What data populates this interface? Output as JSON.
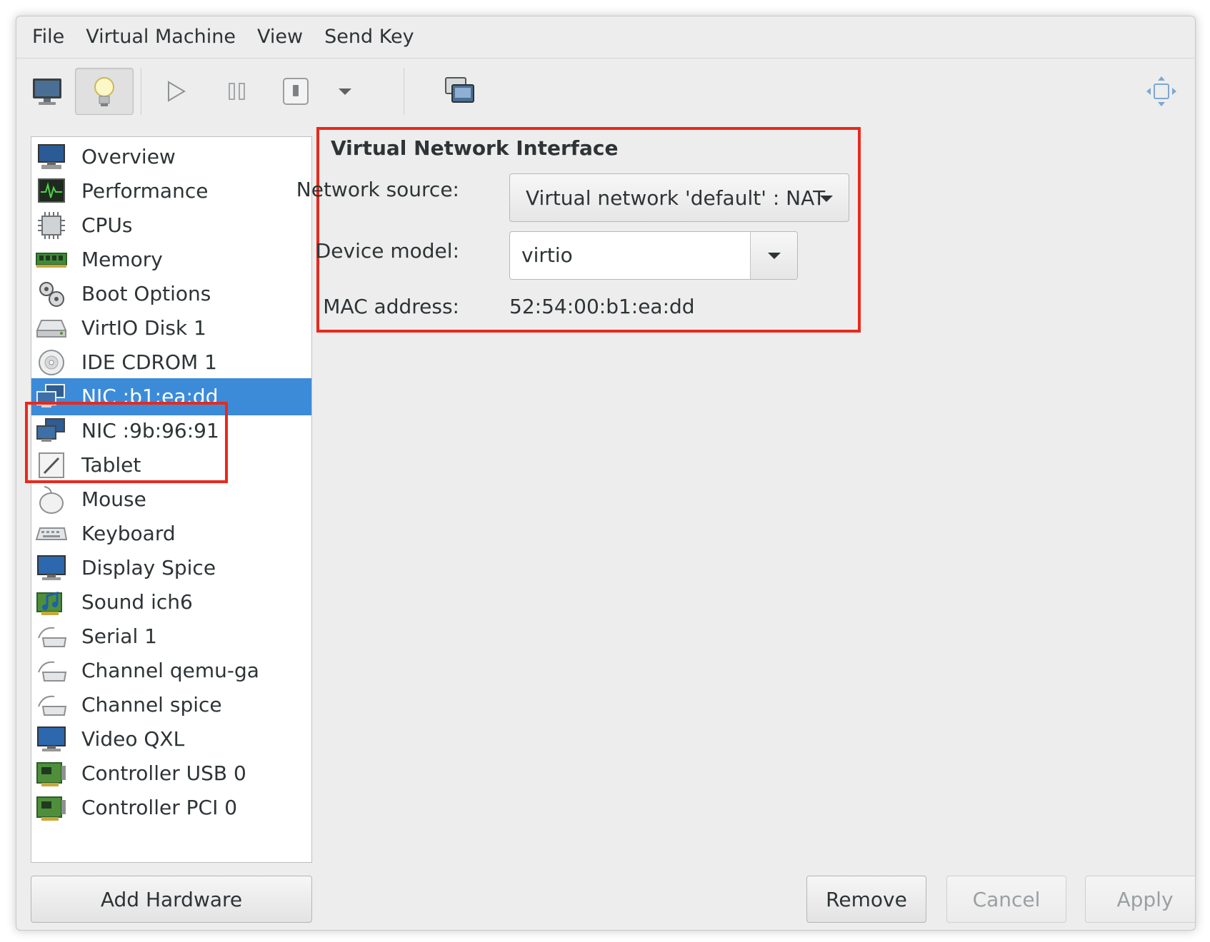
{
  "menubar": {
    "items": [
      "File",
      "Virtual Machine",
      "View",
      "Send Key"
    ]
  },
  "toolbar": {
    "buttons": [
      "monitor-icon",
      "lightbulb-icon",
      "play-icon",
      "pause-icon",
      "power-icon",
      "chevron-down-icon",
      "screenshot-icon",
      "fullscreen-icon"
    ]
  },
  "hardware_list": [
    {
      "label": "Overview",
      "icon": "overview-icon"
    },
    {
      "label": "Performance",
      "icon": "performance-icon"
    },
    {
      "label": "CPUs",
      "icon": "cpu-icon"
    },
    {
      "label": "Memory",
      "icon": "memory-icon"
    },
    {
      "label": "Boot Options",
      "icon": "boot-options-icon"
    },
    {
      "label": "VirtIO Disk 1",
      "icon": "disk-icon"
    },
    {
      "label": "IDE CDROM 1",
      "icon": "cdrom-icon"
    },
    {
      "label": "NIC :b1:ea:dd",
      "icon": "nic-icon",
      "selected": true
    },
    {
      "label": "NIC :9b:96:91",
      "icon": "nic-icon"
    },
    {
      "label": "Tablet",
      "icon": "tablet-icon"
    },
    {
      "label": "Mouse",
      "icon": "mouse-icon"
    },
    {
      "label": "Keyboard",
      "icon": "keyboard-icon"
    },
    {
      "label": "Display Spice",
      "icon": "display-icon"
    },
    {
      "label": "Sound ich6",
      "icon": "sound-icon"
    },
    {
      "label": "Serial 1",
      "icon": "serial-icon"
    },
    {
      "label": "Channel qemu-ga",
      "icon": "channel-icon"
    },
    {
      "label": "Channel spice",
      "icon": "channel-icon"
    },
    {
      "label": "Video QXL",
      "icon": "video-icon"
    },
    {
      "label": "Controller USB 0",
      "icon": "controller-icon"
    },
    {
      "label": "Controller PCI 0",
      "icon": "controller-icon"
    }
  ],
  "details": {
    "title": "Virtual Network Interface",
    "network_source_label": "Network source:",
    "network_source_value": "Virtual network 'default' : NAT",
    "device_model_label": "Device model:",
    "device_model_value": "virtio",
    "mac_label": "MAC address:",
    "mac_value": "52:54:00:b1:ea:dd"
  },
  "buttons": {
    "add_hardware": "Add Hardware",
    "remove": "Remove",
    "cancel": "Cancel",
    "apply": "Apply"
  },
  "colors": {
    "selection": "#3c8bd9",
    "highlight_frame": "#e8291c",
    "window_bg": "#ededed"
  }
}
